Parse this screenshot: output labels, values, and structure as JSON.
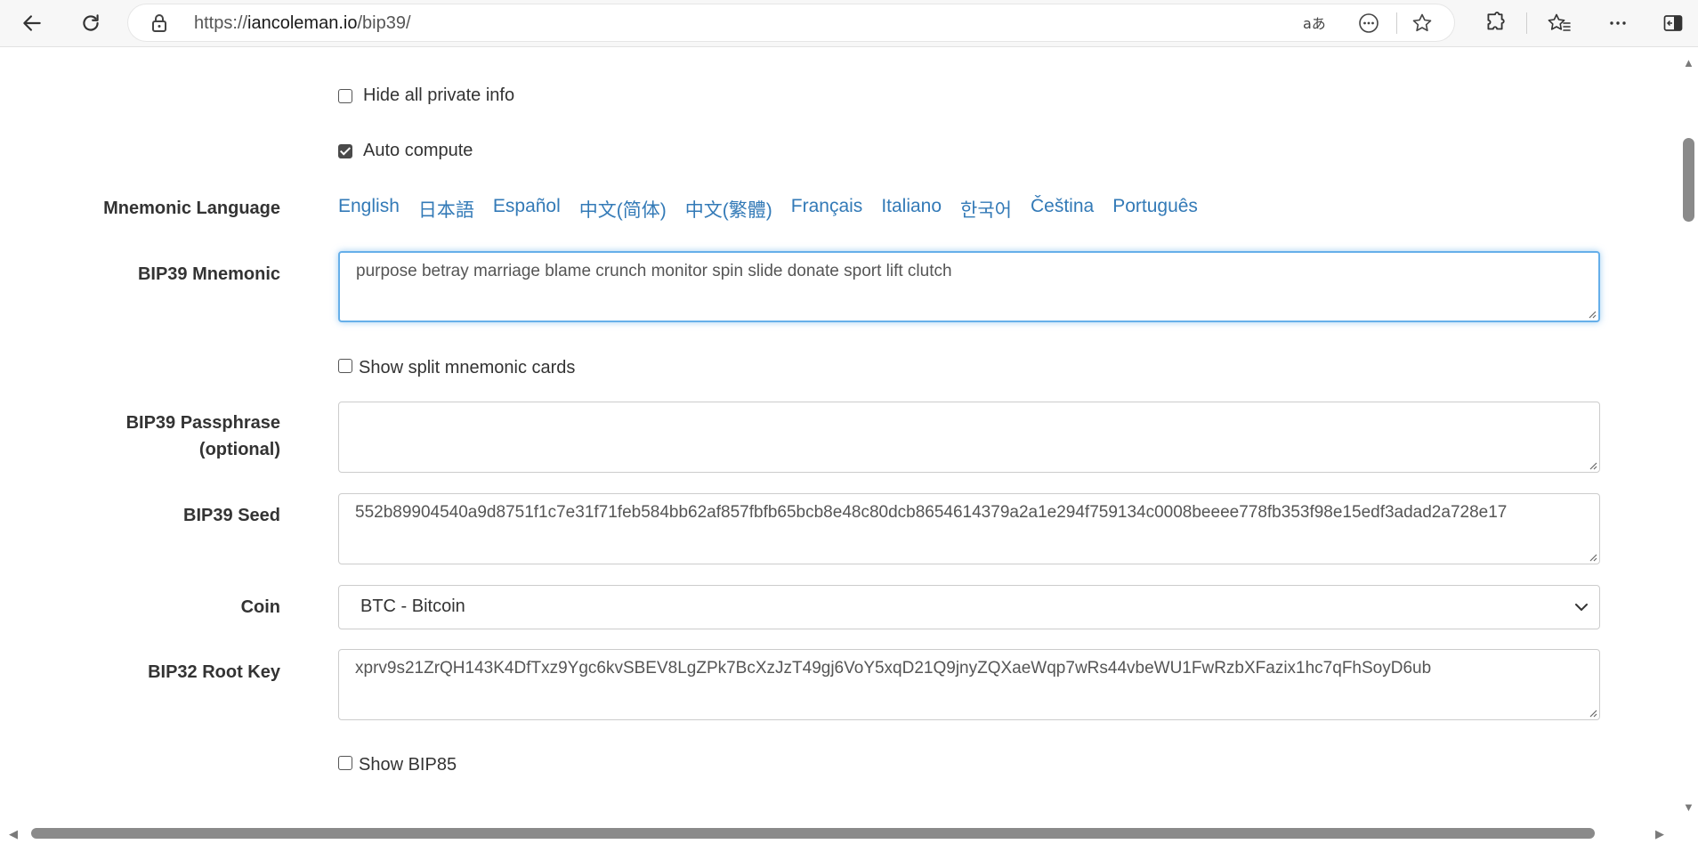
{
  "browser": {
    "url_prefix": "https://",
    "url_host": "iancoleman.io",
    "url_path": "/bip39/",
    "icons": [
      "back-arrow-icon",
      "refresh-icon",
      "lock-icon",
      "read-aloud-icon",
      "more-tools-icon",
      "favorite-star-icon",
      "extensions-icon",
      "favorites-icon",
      "menu-ellipsis-icon",
      "sidebar-icon"
    ]
  },
  "options": {
    "hide_private_info": {
      "label": "Hide all private info",
      "checked": false
    },
    "auto_compute": {
      "label": "Auto compute",
      "checked": true
    }
  },
  "mnemonic_language": {
    "label": "Mnemonic Language",
    "languages": [
      "English",
      "日本語",
      "Español",
      "中文(简体)",
      "中文(繁體)",
      "Français",
      "Italiano",
      "한국어",
      "Čeština",
      "Português"
    ]
  },
  "bip39_mnemonic": {
    "label": "BIP39 Mnemonic",
    "value": "purpose betray marriage blame crunch monitor spin slide donate sport lift clutch"
  },
  "split_cards": {
    "label": "Show split mnemonic cards",
    "checked": false
  },
  "bip39_passphrase": {
    "label_line1": "BIP39 Passphrase",
    "label_line2": "(optional)",
    "value": ""
  },
  "bip39_seed": {
    "label": "BIP39 Seed",
    "value": "552b89904540a9d8751f1c7e31f71feb584bb62af857fbfb65bcb8e48c80dcb8654614379a2a1e294f759134c0008beeee778fb353f98e15edf3adad2a728e17"
  },
  "coin": {
    "label": "Coin",
    "value": "BTC - Bitcoin"
  },
  "bip32_root_key": {
    "label": "BIP32 Root Key",
    "value": "xprv9s21ZrQH143K4DfTxz9Ygc6kvSBEV8LgZPk7BcXzJzT49gj6VoY5xqD21Q9jnyZQXaeWqp7wRs44vbeWU1FwRzbXFazix1hc7qFhSoyD6ub"
  },
  "bip85": {
    "label": "Show BIP85",
    "checked": false
  },
  "colors": {
    "link": "#337ab7",
    "focus": "#66afe9",
    "label": "#333333"
  }
}
